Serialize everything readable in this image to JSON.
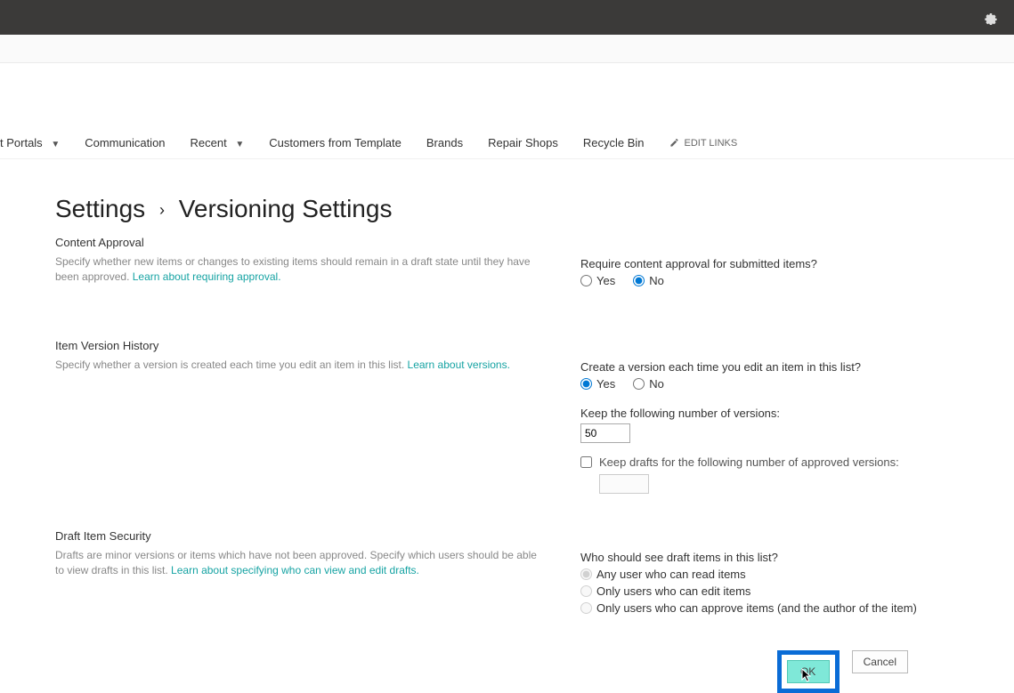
{
  "header": {
    "gear_icon": "settings"
  },
  "nav": {
    "items": [
      {
        "label": "t Portals",
        "has_caret": true
      },
      {
        "label": "Communication",
        "has_caret": false
      },
      {
        "label": "Recent",
        "has_caret": true
      },
      {
        "label": "Customers from Template",
        "has_caret": false
      },
      {
        "label": "Brands",
        "has_caret": false
      },
      {
        "label": "Repair Shops",
        "has_caret": false
      },
      {
        "label": "Recycle Bin",
        "has_caret": false
      }
    ],
    "edit_links": "EDIT LINKS"
  },
  "breadcrumb": {
    "settings": "Settings",
    "page": "Versioning Settings"
  },
  "sections": {
    "approval": {
      "heading": "Content Approval",
      "desc": "Specify whether new items or changes to existing items should remain in a draft state until they have been approved.  ",
      "link": "Learn about requiring approval.",
      "question": "Require content approval for submitted items?",
      "yes": "Yes",
      "no": "No",
      "selected": "no"
    },
    "history": {
      "heading": "Item Version History",
      "desc": "Specify whether a version is created each time you edit an item in this list.  ",
      "link": "Learn about versions.",
      "question": "Create a version each time you edit an item in this list?",
      "yes": "Yes",
      "no": "No",
      "selected": "yes",
      "keep_label": "Keep the following number of versions:",
      "keep_value": "50",
      "drafts_label": "Keep drafts for the following number of approved versions:",
      "drafts_checked": false,
      "drafts_value": ""
    },
    "draft_security": {
      "heading": "Draft Item Security",
      "desc": "Drafts are minor versions or items which have not been approved. Specify which users should be able to view drafts in this list.  ",
      "link": "Learn about specifying who can view and edit drafts.",
      "question": "Who should see draft items in this list?",
      "opt1": "Any user who can read items",
      "opt2": "Only users who can edit items",
      "opt3": "Only users who can approve items (and the author of the item)",
      "selected": "opt1"
    }
  },
  "buttons": {
    "ok": "OK",
    "cancel": "Cancel"
  }
}
